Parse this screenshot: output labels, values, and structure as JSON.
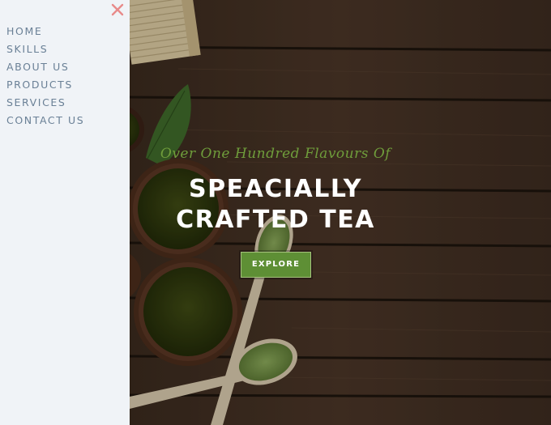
{
  "sidebar": {
    "close_icon": "close-icon",
    "close_color": "#e88a8a",
    "items": [
      {
        "label": "HOME"
      },
      {
        "label": "SKILLS"
      },
      {
        "label": "ABOUT US"
      },
      {
        "label": "PRODUCTS"
      },
      {
        "label": "SERVICES"
      },
      {
        "label": "CONTACT US"
      }
    ]
  },
  "hero": {
    "tagline": "Over One Hundred Flavours Of",
    "headline_line1": "SPEACIALLY",
    "headline_line2": "CRAFTED TEA",
    "button_label": "EXPLORE",
    "accent_color": "#6f9d3b"
  }
}
